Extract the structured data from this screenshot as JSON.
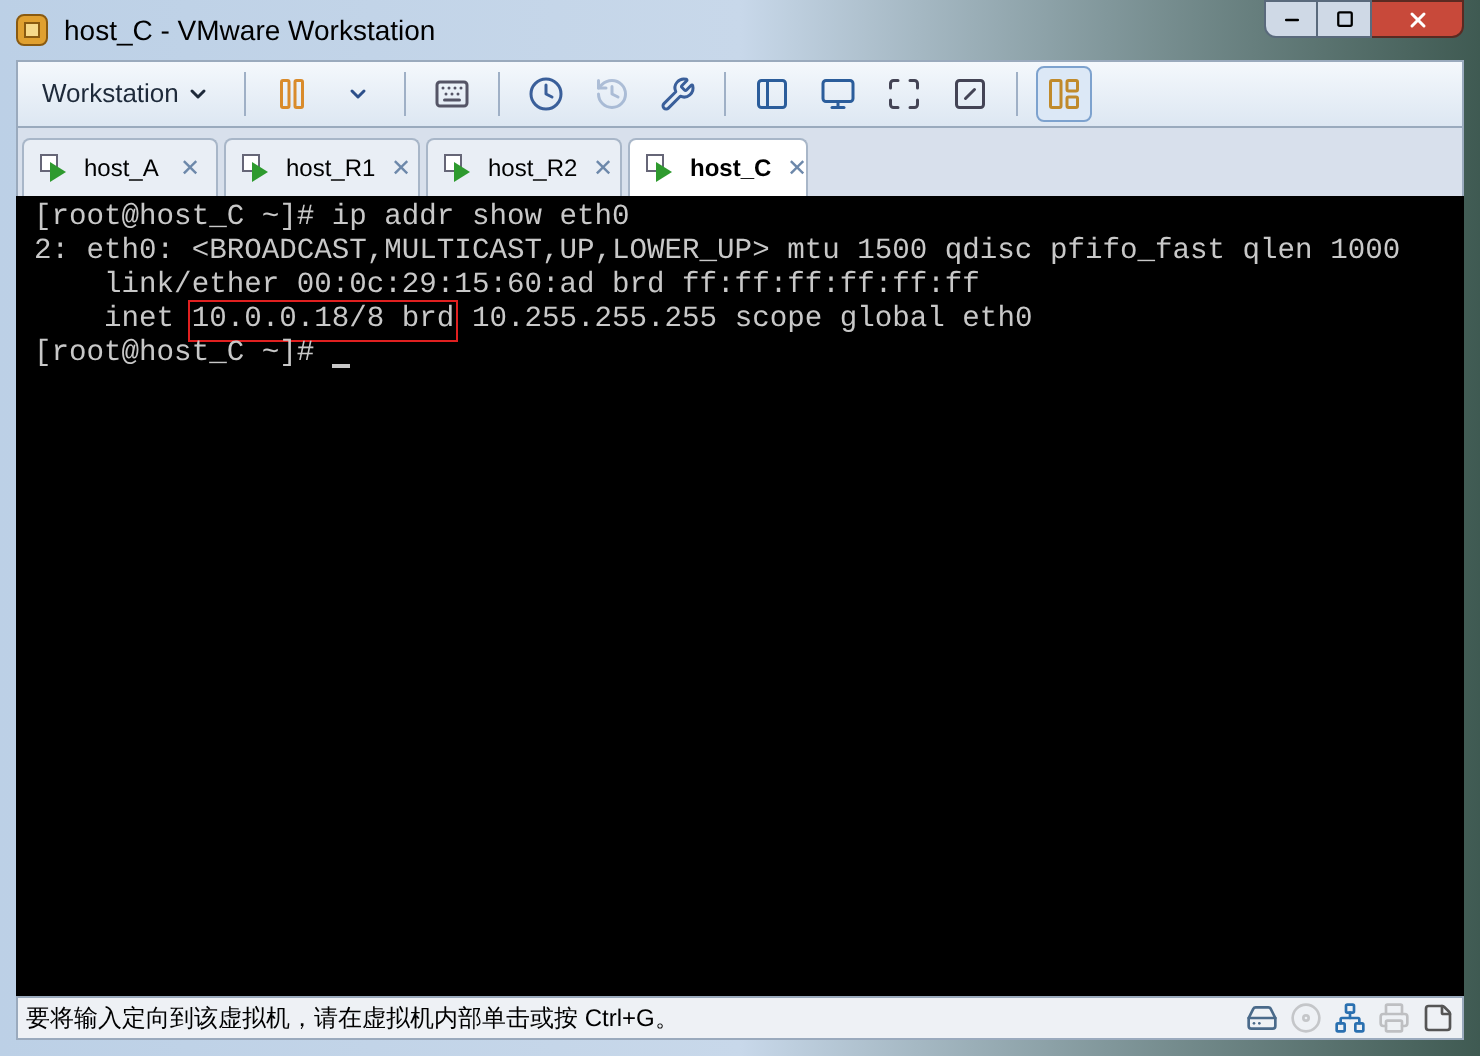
{
  "window": {
    "title": "host_C - VMware Workstation"
  },
  "toolbar": [
    {
      "kind": "menu",
      "label": "Workstation"
    },
    {
      "kind": "pause",
      "disabled": false,
      "selected": false
    },
    {
      "kind": "caret",
      "disabled": false,
      "selected": false
    },
    {
      "kind": "send-keys",
      "disabled": false,
      "selected": false
    },
    {
      "kind": "snapshot",
      "disabled": false,
      "selected": false
    },
    {
      "kind": "revert",
      "disabled": true,
      "selected": false
    },
    {
      "kind": "snapshot-manager",
      "disabled": false,
      "selected": false
    },
    {
      "kind": "sidebar",
      "disabled": false,
      "selected": false
    },
    {
      "kind": "console",
      "disabled": false,
      "selected": false
    },
    {
      "kind": "fullscreen",
      "disabled": false,
      "selected": false
    },
    {
      "kind": "unity",
      "disabled": false,
      "selected": false
    },
    {
      "kind": "thumbnails",
      "disabled": false,
      "selected": true
    }
  ],
  "tabs": [
    {
      "label": "host_A",
      "selected": false,
      "close": "✕"
    },
    {
      "label": "host_R1",
      "selected": false,
      "close": "✕"
    },
    {
      "label": "host_R2",
      "selected": false,
      "close": "✕"
    },
    {
      "label": "host_C",
      "selected": true,
      "close": "✕"
    }
  ],
  "terminal": {
    "lines": [
      {
        "parts": [
          {
            "text": "[root@host_C ~]# ip addr show eth0",
            "highlighted": false
          }
        ]
      },
      {
        "parts": [
          {
            "text": "2: eth0: <BROADCAST,MULTICAST,UP,LOWER_UP> mtu 1500 qdisc pfifo_fast qlen 1000",
            "highlighted": false
          }
        ]
      },
      {
        "parts": [
          {
            "text": "    link/ether 00:0c:29:15:60:ad brd ff:ff:ff:ff:ff:ff",
            "highlighted": false
          }
        ]
      },
      {
        "parts": [
          {
            "text": "    inet ",
            "highlighted": false
          },
          {
            "text": "10.0.0.18/8 brd",
            "highlighted": true
          },
          {
            "text": " 10.255.255.255 scope global eth0",
            "highlighted": false
          }
        ]
      },
      {
        "parts": [
          {
            "text": "[root@host_C ~]# ",
            "highlighted": false
          }
        ],
        "cursor": true
      }
    ]
  },
  "status_bar": {
    "message": "要将输入定向到该虚拟机，请在虚拟机内部单击或按 Ctrl+G。",
    "devices": [
      {
        "kind": "disk",
        "disabled": false
      },
      {
        "kind": "cd",
        "disabled": true
      },
      {
        "kind": "network",
        "disabled": false
      },
      {
        "kind": "printer",
        "disabled": true
      },
      {
        "kind": "message",
        "disabled": false
      }
    ]
  }
}
